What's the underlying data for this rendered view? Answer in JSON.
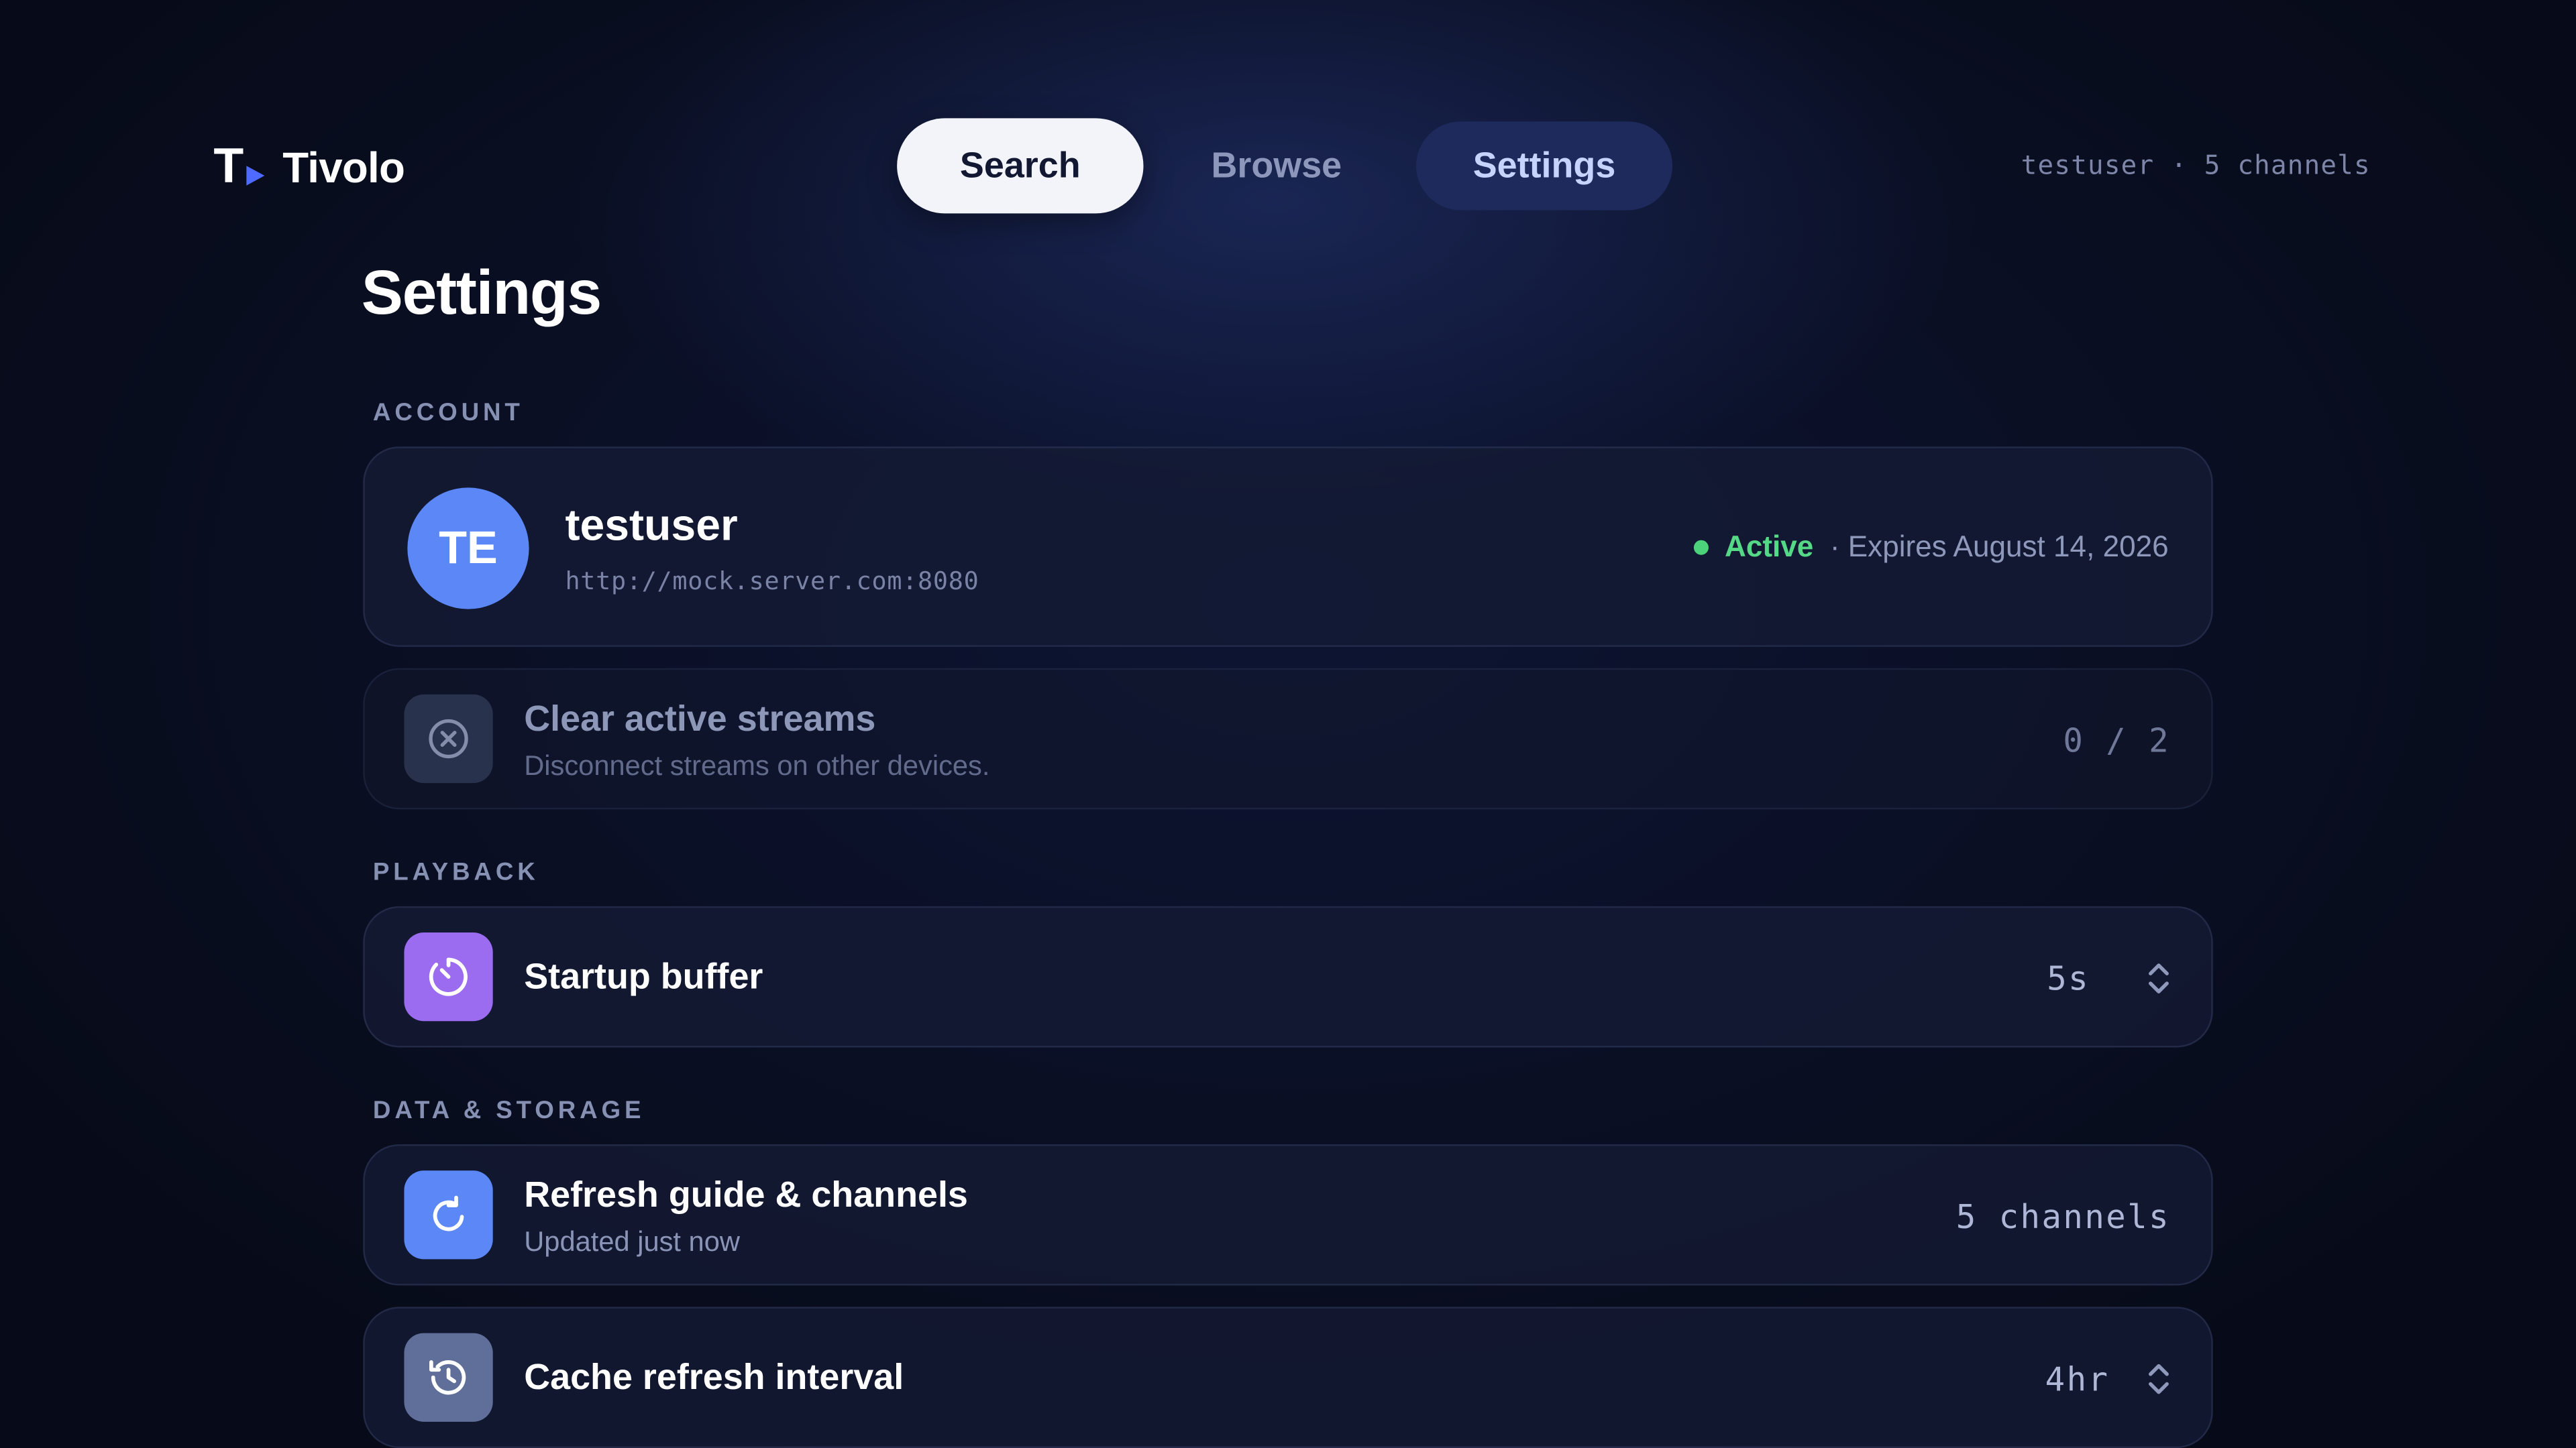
{
  "app": {
    "name": "Tivolo"
  },
  "nav": {
    "search": "Search",
    "browse": "Browse",
    "settings": "Settings"
  },
  "header": {
    "meta": "testuser · 5 channels"
  },
  "page": {
    "title": "Settings"
  },
  "sections": {
    "account": "ACCOUNT",
    "playback": "PLAYBACK",
    "data_storage": "DATA & STORAGE"
  },
  "account": {
    "initials": "TE",
    "username": "testuser",
    "server_url": "http://mock.server.com:8080",
    "status": "Active",
    "expires": "· Expires August 14, 2026",
    "status_color": "#55d986"
  },
  "rows": {
    "clear_streams": {
      "title": "Clear active streams",
      "subtitle": "Disconnect streams on other devices.",
      "value": "0 / 2",
      "icon": "close-circle-icon"
    },
    "startup_buffer": {
      "title": "Startup buffer",
      "value": "5s",
      "icon": "timer-icon",
      "color": "#9b6cf0"
    },
    "refresh_guide": {
      "title": "Refresh guide & channels",
      "subtitle": "Updated just now",
      "value": "5 channels",
      "icon": "refresh-icon",
      "color": "#5b87f7"
    },
    "cache_interval": {
      "title": "Cache refresh interval",
      "value": "4hr",
      "icon": "history-icon",
      "color": "#5f6f9a"
    }
  }
}
